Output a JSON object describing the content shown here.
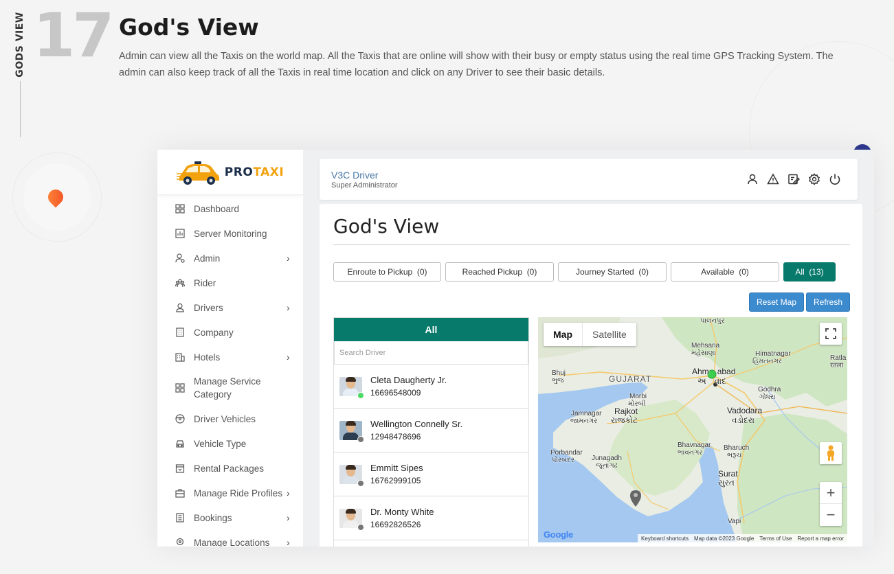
{
  "slide": {
    "section_label": "GODS VIEW",
    "number": "17",
    "title": "God's View",
    "description": "Admin can view all the Taxis on the world map. All the Taxis that are online will show with their busy or empty status using the real time GPS Tracking System. The admin can also keep track of all the Taxis in real time location and click on any Driver to see their basic details."
  },
  "logo": {
    "part1": "PRO",
    "part2": "TAXI"
  },
  "sidebar": {
    "items": [
      {
        "label": "Dashboard",
        "icon": "dashboard-icon",
        "has_chevron": false
      },
      {
        "label": "Server Monitoring",
        "icon": "chart-icon",
        "has_chevron": false
      },
      {
        "label": "Admin",
        "icon": "admin-user-icon",
        "has_chevron": true
      },
      {
        "label": "Rider",
        "icon": "group-icon",
        "has_chevron": false
      },
      {
        "label": "Drivers",
        "icon": "user-icon",
        "has_chevron": true
      },
      {
        "label": "Company",
        "icon": "building-icon",
        "has_chevron": false
      },
      {
        "label": "Hotels",
        "icon": "hotel-icon",
        "has_chevron": true
      },
      {
        "label": "Manage Service Category",
        "icon": "grid-icon",
        "has_chevron": false
      },
      {
        "label": "Driver Vehicles",
        "icon": "steering-icon",
        "has_chevron": false
      },
      {
        "label": "Vehicle Type",
        "icon": "car-icon",
        "has_chevron": false
      },
      {
        "label": "Rental Packages",
        "icon": "package-icon",
        "has_chevron": false
      },
      {
        "label": "Manage Ride Profiles",
        "icon": "briefcase-icon",
        "has_chevron": true
      },
      {
        "label": "Bookings",
        "icon": "list-icon",
        "has_chevron": true
      },
      {
        "label": "Manage Locations",
        "icon": "location-icon",
        "has_chevron": true
      }
    ],
    "chevron": "›"
  },
  "topbar": {
    "user_name": "V3C Driver",
    "user_role": "Super Administrator",
    "icons": [
      "profile-icon",
      "alert-icon",
      "edit-icon",
      "settings-icon",
      "power-icon"
    ]
  },
  "main": {
    "title": "God's View",
    "filters": [
      {
        "label": "Enroute to Pickup",
        "count": "(0)",
        "active": false
      },
      {
        "label": "Reached Pickup",
        "count": "(0)",
        "active": false
      },
      {
        "label": "Journey Started",
        "count": "(0)",
        "active": false
      },
      {
        "label": "Available",
        "count": "(0)",
        "active": false
      },
      {
        "label": "All",
        "count": "(13)",
        "active": true
      }
    ],
    "reset_label": "Reset Map",
    "refresh_label": "Refresh"
  },
  "driver_list": {
    "header": "All",
    "search_placeholder": "Search Driver",
    "drivers": [
      {
        "name": "Cleta Daugherty Jr.",
        "phone": "16696548009",
        "status_color": "#4cd964"
      },
      {
        "name": "Wellington Connelly Sr.",
        "phone": "12948478696",
        "status_color": "#777777"
      },
      {
        "name": "Emmitt Sipes",
        "phone": "16762999105",
        "status_color": "#777777"
      },
      {
        "name": "Dr. Monty White",
        "phone": "16692826526",
        "status_color": "#777777"
      }
    ]
  },
  "map": {
    "toggle_map": "Map",
    "toggle_satellite": "Satellite",
    "zoom_in": "+",
    "zoom_out": "−",
    "google": "Google",
    "footer": [
      "Keyboard shortcuts",
      "Map data ©2023 Google",
      "Terms of Use",
      "Report a map error"
    ],
    "labels": {
      "palanpur": "પાલનપુર",
      "mehsana": "Mehsana",
      "mehsana_gu": "મહેસાણા",
      "himatnagar": "Himatnagar",
      "himatnagar_gu": "હિંમતનગર",
      "ratlam": "Ratla",
      "ratlam_hi": "रतला",
      "bhuj": "Bhuj",
      "bhuj_gu": "ભુજ",
      "gujarat": "GUJARAT",
      "ahmedabad_a": "Ahm",
      "ahmedabad_b": "abad",
      "ahmedabad_gu_a": "અ",
      "ahmedabad_gu_b": "વાદ",
      "godhra": "Godhra",
      "godhra_gu": "ગોધરા",
      "morbi": "Morbi",
      "morbi_gu": "મોરબી",
      "jamnagar": "Jamnagar",
      "jamnagar_gu": "જામનગર",
      "rajkot": "Rajkot",
      "rajkot_gu": "રાજકોટ",
      "vadodara": "Vadodara",
      "vadodara_gu": "વડોદરા",
      "porbandar": "Porbandar",
      "porbandar_gu": "પોરબંદર",
      "junagadh": "Junagadh",
      "junagadh_gu": "જૂનાગઢ",
      "bhavnagar": "Bhavnagar",
      "bhavnagar_gu": "ભાવનગર",
      "bharuch": "Bharuch",
      "bharuch_gu": "ભરૂચ",
      "surat": "Surat",
      "surat_gu": "સુરત",
      "vapi": "Vapi"
    },
    "colors": {
      "land": "#e9ede3",
      "green": "#cfe6c2",
      "water": "#a4c8f0",
      "marker_online": "#3ccf4e",
      "marker_offline": "#555555"
    }
  }
}
